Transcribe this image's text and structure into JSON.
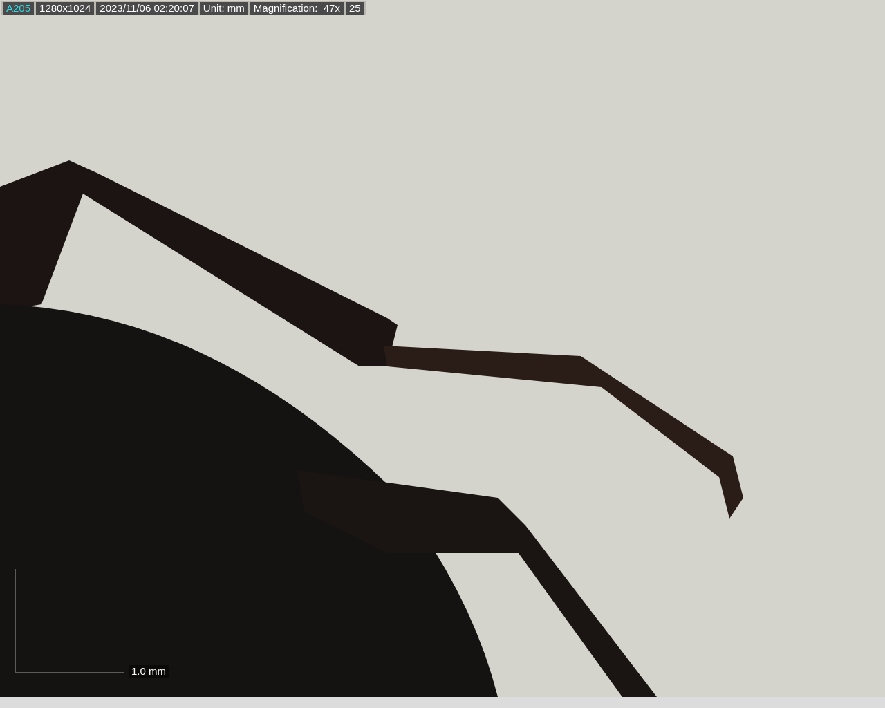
{
  "info_bar": [
    {
      "text": "A205",
      "kind": "highlight"
    },
    {
      "text": "1280x1024",
      "kind": "plain"
    },
    {
      "text": "2023/11/06 02:20:07",
      "kind": "plain"
    },
    {
      "text": "Unit: mm",
      "kind": "plain"
    },
    {
      "text": "Magnification:  47x",
      "kind": "plain"
    },
    {
      "text": "25",
      "kind": "plain"
    }
  ],
  "scale_bar": {
    "label": "1.0 mm"
  }
}
